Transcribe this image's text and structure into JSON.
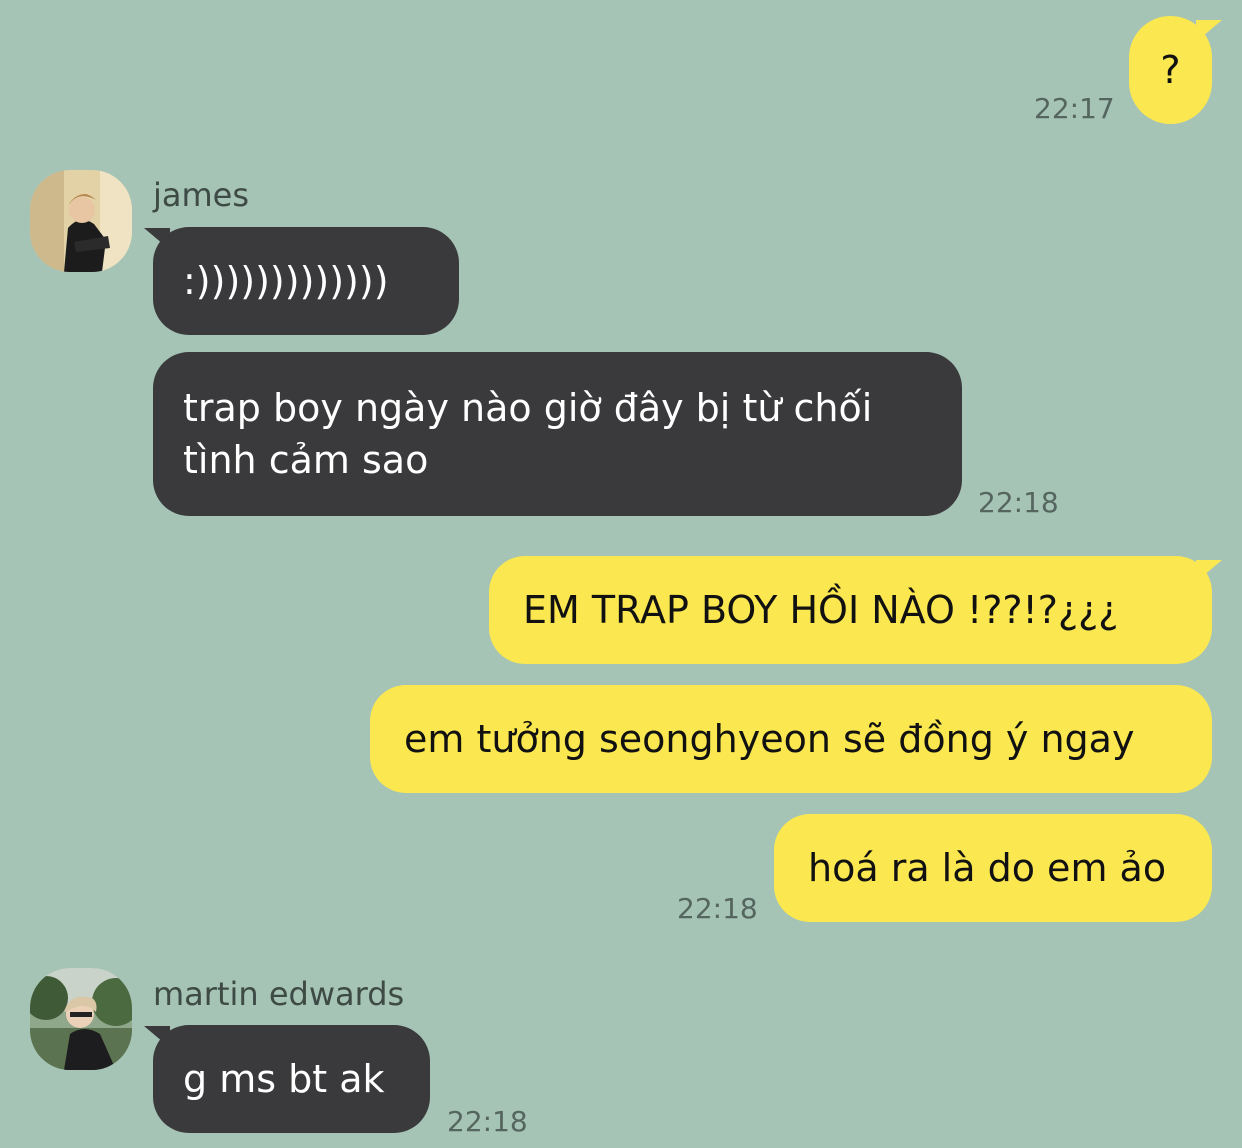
{
  "colors": {
    "background": "#a6c4b6",
    "outgoing_bubble": "#fbe74f",
    "incoming_bubble": "#3a3a3c"
  },
  "messages": {
    "out_1": {
      "text": "?",
      "time": "22:17"
    },
    "james": {
      "name": "james",
      "msg_1": ":)))))))))))))",
      "msg_2": "trap boy ngày nào giờ đây bị từ chối tình cảm sao",
      "time": "22:18"
    },
    "out_2": {
      "msg_1": "EM TRAP BOY HỒI NÀO !??!?¿¿¿",
      "msg_2": "em tưởng seonghyeon sẽ đồng ý ngay",
      "msg_3": "hoá ra là do em ảo",
      "time": "22:18"
    },
    "martin": {
      "name": "martin edwards",
      "msg_1": "g ms bt ak",
      "time": "22:18"
    }
  }
}
